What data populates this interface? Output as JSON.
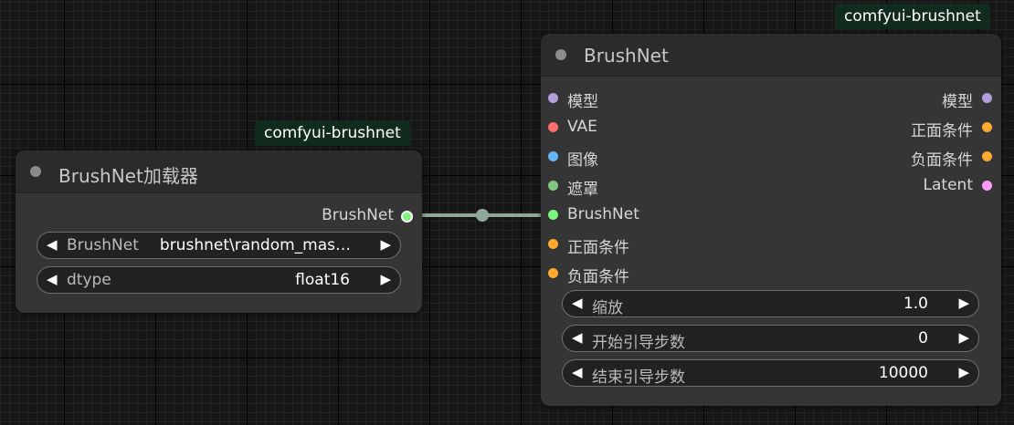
{
  "colors": {
    "model": "#b39ddb",
    "vae": "#ff6e6e",
    "image": "#64b5f6",
    "mask": "#81c784",
    "brushnet": "#7cf57c",
    "conditioning": "#ffa931",
    "latent": "#ff9cf9",
    "link": "#8fa89b"
  },
  "loader_node": {
    "badge": "comfyui-brushnet",
    "title": "BrushNet加载器",
    "output_label": "BrushNet",
    "widgets": [
      {
        "label": "BrushNet",
        "value": "brushnet\\random_mas…"
      },
      {
        "label": "dtype",
        "value": "float16"
      }
    ]
  },
  "brushnet_node": {
    "badge": "comfyui-brushnet",
    "title": "BrushNet",
    "inputs": [
      "模型",
      "VAE",
      "图像",
      "遮罩",
      "BrushNet",
      "正面条件",
      "负面条件"
    ],
    "outputs": [
      "模型",
      "正面条件",
      "负面条件",
      "Latent"
    ],
    "widgets": [
      {
        "label": "缩放",
        "value": "1.0"
      },
      {
        "label": "开始引导步数",
        "value": "0"
      },
      {
        "label": "结束引导步数",
        "value": "10000"
      }
    ]
  },
  "icons": {
    "arrow_left": "◀",
    "arrow_right": "▶"
  }
}
